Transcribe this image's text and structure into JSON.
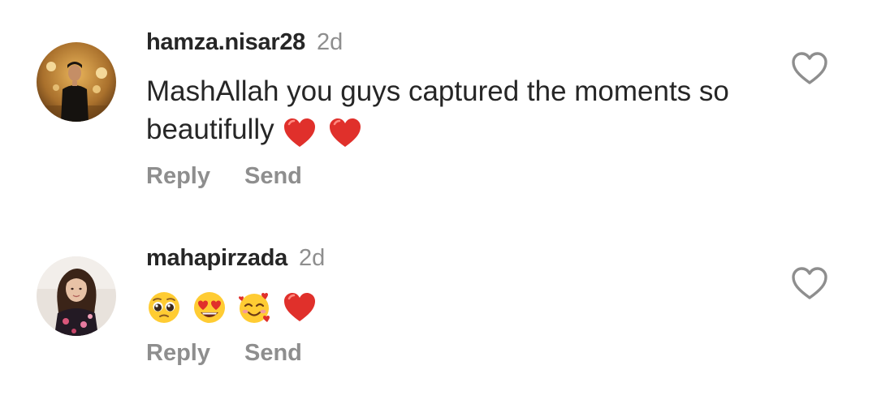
{
  "comments": [
    {
      "username": "hamza.nisar28",
      "time": "2d",
      "text": "MashAllah you guys captured the moments so beautifully",
      "emojis": [
        "red-heart",
        "red-heart"
      ],
      "actions": {
        "reply": "Reply",
        "send": "Send"
      }
    },
    {
      "username": "mahapirzada",
      "time": "2d",
      "text": "",
      "emojis": [
        "pleading-face",
        "heart-eyes-face",
        "smiling-face-with-hearts",
        "red-heart"
      ],
      "actions": {
        "reply": "Reply",
        "send": "Send"
      }
    }
  ],
  "colors": {
    "text": "#262626",
    "muted": "#8e8e8e",
    "heart_emoji": "#e0302b",
    "emoji_face": "#ffcc33"
  },
  "icons": {
    "like": "heart-outline-icon"
  }
}
